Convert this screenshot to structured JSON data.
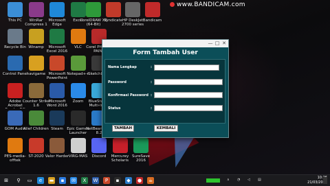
{
  "recorder": {
    "label": "www.BANDICAM.com"
  },
  "desktop_icons": [
    {
      "label": "This PC",
      "icon": "computer-icon",
      "color": "#3b8ed6"
    },
    {
      "label": "WinRar Compress 1",
      "icon": "winrar-icon",
      "color": "#8a3a8a"
    },
    {
      "label": "Microsoft Edge",
      "icon": "edge-icon",
      "color": "#1f88d8"
    },
    {
      "label": "Excel",
      "icon": "excel-icon",
      "color": "#1f7a44"
    },
    {
      "label": "CorelDRAW X8 (64-Bit)",
      "icon": "coreldraw-icon",
      "color": "#2e9a3a"
    },
    {
      "label": "Syndicate",
      "icon": "game-icon",
      "color": "#c23a2a"
    },
    {
      "label": "HP DeskJet 2700 series",
      "icon": "printer-icon",
      "color": "#666"
    },
    {
      "label": "Bandicam",
      "icon": "bandicam-icon",
      "color": "#c02a2a"
    },
    {
      "label": "Recycle Bin",
      "icon": "recycle-bin-icon",
      "color": "#6a7a8a"
    },
    {
      "label": "Winamp",
      "icon": "winamp-icon",
      "color": "#c8a020"
    },
    {
      "label": "Microsoft Excel 2016",
      "icon": "excel-icon",
      "color": "#1f7a44"
    },
    {
      "label": "VLC",
      "icon": "vlc-icon",
      "color": "#e07a10"
    },
    {
      "label": "Corel PHOTO-PAINT",
      "icon": "corel-photopaint-icon",
      "color": "#b82a2a"
    },
    {
      "label": "Control Panel",
      "icon": "control-panel-icon",
      "color": "#2a6ab0"
    },
    {
      "label": "navigame",
      "icon": "folder-icon",
      "color": "#d8a020"
    },
    {
      "label": "Microsoft PowerPoint",
      "icon": "powerpoint-icon",
      "color": "#c8482a"
    },
    {
      "label": "Notepad++",
      "icon": "notepad-icon",
      "color": "#5a9a3a"
    },
    {
      "label": "Sketchbook",
      "icon": "sketchbook-icon",
      "color": "#3a3a3a"
    },
    {
      "label": "Adobe Acrobat Reader DC",
      "icon": "acrobat-icon",
      "color": "#c82020"
    },
    {
      "label": "Counter Strike 1.6",
      "icon": "cs-icon",
      "color": "#8a6a3a"
    },
    {
      "label": "Microsoft Word 2016",
      "icon": "word-icon",
      "color": "#2a5aa8"
    },
    {
      "label": "Zoom",
      "icon": "zoom-icon",
      "color": "#2a8ae8"
    },
    {
      "label": "BlueStacks Multi-Insta",
      "icon": "bluestacks-icon",
      "color": "#3aa8d8"
    },
    {
      "label": "GOM Audio",
      "icon": "gom-icon",
      "color": "#3a6ab8"
    },
    {
      "label": "Alief Children",
      "icon": "alien-icon",
      "color": "#4a8a3a"
    },
    {
      "label": "Steam",
      "icon": "steam-icon",
      "color": "#1a3a5a"
    },
    {
      "label": "Epic Games Launcher",
      "icon": "epic-icon",
      "color": "#2a2a2a"
    },
    {
      "label": "NetBeans IDE 8.2",
      "icon": "netbeans-icon",
      "color": "#2a7ac8"
    },
    {
      "label": "PES-media-offtek",
      "icon": "vlc-icon",
      "color": "#e07a10"
    },
    {
      "label": "ST-2020",
      "icon": "game-icon",
      "color": "#c83a2a"
    },
    {
      "label": "Valor Harder",
      "icon": "game-icon",
      "color": "#8a5a3a"
    },
    {
      "label": "VIRG-MAS",
      "icon": "file-icon",
      "color": "#cfcfcf"
    },
    {
      "label": "Discord",
      "icon": "discord-icon",
      "color": "#5865f2"
    },
    {
      "label": "Mercurey Scholaris",
      "icon": "game-icon",
      "color": "#c8202a"
    },
    {
      "label": "SureSave 2016",
      "icon": "app-icon",
      "color": "#1a9a5a"
    }
  ],
  "dialog": {
    "title": "Form Tambah User",
    "fields": [
      {
        "label": "Nama Lengkap",
        "colon": ":",
        "value": ""
      },
      {
        "label": "Password",
        "colon": ":",
        "value": ""
      },
      {
        "label": "Konfirmasi Password",
        "colon": ":",
        "value": ""
      },
      {
        "label": "Status",
        "colon": ":",
        "value": ""
      }
    ],
    "buttons": {
      "add": "TAMBAH",
      "back": "KEMBALI"
    },
    "controls": {
      "minimize": "—",
      "maximize": "□",
      "close": "✕"
    }
  },
  "taskbar": {
    "clock_time": "10:26",
    "clock_date": "21/03/2021"
  }
}
